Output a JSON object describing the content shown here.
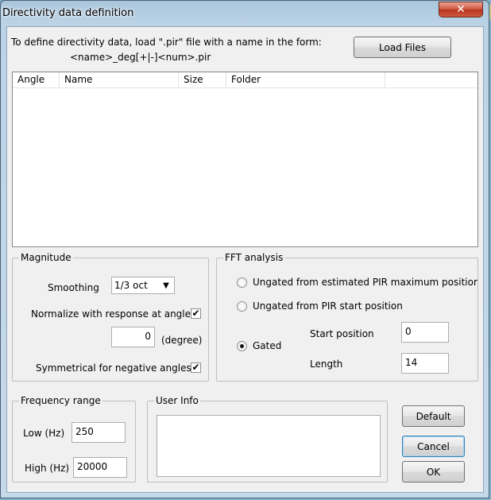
{
  "window": {
    "title": "Directivity data definition",
    "close_glyph": "✕"
  },
  "intro": {
    "line1": "To define directivity data, load \".pir\" file with a name in the form:",
    "line2": "<name>_deg[+|-]<num>.pir"
  },
  "buttons": {
    "load_files": "Load Files",
    "default": "Default",
    "cancel": "Cancel",
    "ok": "OK"
  },
  "list": {
    "columns": [
      "Angle",
      "Name",
      "Size",
      "Folder"
    ]
  },
  "magnitude": {
    "title": "Magnitude",
    "smoothing_label": "Smoothing",
    "smoothing_value": "1/3 oct",
    "normalize_label": "Normalize with response at angle",
    "normalize_checked": "✔",
    "angle_value": "0",
    "degree_label": "(degree)",
    "symmetric_label": "Symmetrical for negative angles",
    "symmetric_checked": "✔"
  },
  "fft": {
    "title": "FFT analysis",
    "option_ungated_max": "Ungated from estimated  PIR maximum  positior",
    "option_ungated_start": "Ungated from PIR start position",
    "option_gated": "Gated",
    "start_label": "Start position",
    "start_value": "0",
    "length_label": "Length",
    "length_value": "14"
  },
  "frequency": {
    "title": "Frequency range",
    "low_label": "Low (Hz)",
    "low_value": "250",
    "high_label": "High (Hz)",
    "high_value": "20000"
  },
  "user_info": {
    "title": "User Info",
    "value": ""
  },
  "colors": {
    "titlebar": "#bcd3e6",
    "close_red": "#c94a31",
    "client_bg": "#f0f0f0"
  }
}
